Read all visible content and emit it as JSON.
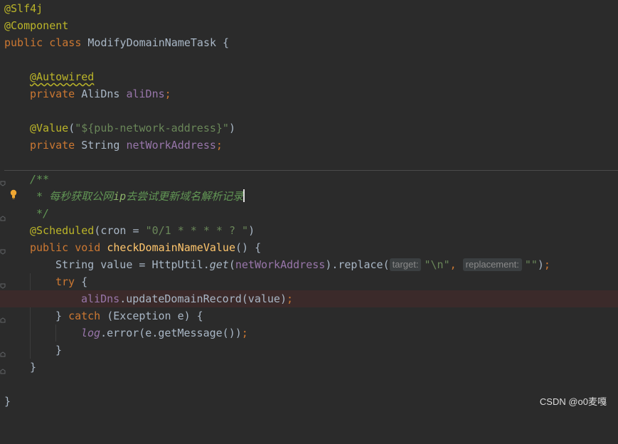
{
  "code": {
    "l1_ann": "@Slf4j",
    "l2_ann": "@Component",
    "l3_kw": "public class ",
    "l3_name": "ModifyDomainNameTask {",
    "l5_ann": "@Autowired",
    "l6_kw": "private ",
    "l6_type": "AliDns ",
    "l6_fld": "aliDns",
    "l6_semi": ";",
    "l8_ann": "@Value",
    "l8_open": "(",
    "l8_str": "\"${pub-network-address}\"",
    "l8_close": ")",
    "l9_kw": "private ",
    "l9_type": "String ",
    "l9_fld": "netWorkAddress",
    "l9_semi": ";",
    "doc_open": "/**",
    "doc_star": " * ",
    "doc_text1": "每秒获取公网",
    "doc_text2": "ip",
    "doc_text3": "去尝试更新域名解析记录",
    "doc_close": " */",
    "l14_ann": "@Scheduled",
    "l14_rest1": "(cron = ",
    "l14_str": "\"0/1 * * * * ? \"",
    "l14_rest2": ")",
    "l15_kw": "public void ",
    "l15_mth": "checkDomainNameValue",
    "l15_rest": "() {",
    "l16_a": "String value = HttpUtil.",
    "l16_get": "get",
    "l16_b": "(",
    "l16_fld": "netWorkAddress",
    "l16_c": ").replace(",
    "l16_hint1": "target:",
    "l16_str1": "\"\\n\"",
    "l16_comma": ", ",
    "l16_hint2": "replacement:",
    "l16_str2": "\"\"",
    "l16_end": ")",
    "l16_semi": ";",
    "l17_kw": "try",
    "l17_rest": " {",
    "l18_fld": "aliDns",
    "l18_rest": ".updateDomainRecord(value)",
    "l18_semi": ";",
    "l19_a": "} ",
    "l19_kw": "catch",
    "l19_b": " (Exception e) {",
    "l20_fld": "log",
    "l20_rest": ".error(e.getMessage())",
    "l20_semi": ";",
    "l21": "}",
    "l22": "}",
    "l24": "}"
  },
  "watermark": "CSDN @o0麦嘎",
  "icons": {
    "bulb": "lightbulb-icon",
    "fold": "fold-marker-icon"
  },
  "colors": {
    "background": "#2b2b2b",
    "keyword": "#cc7832",
    "annotation": "#bbb529",
    "string": "#6a8759",
    "field": "#9876aa",
    "method": "#ffc66d"
  }
}
